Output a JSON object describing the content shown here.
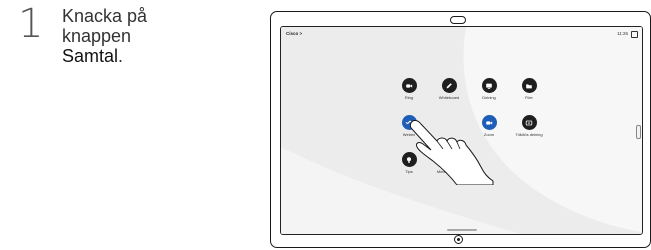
{
  "step": {
    "number": "1"
  },
  "instruction": {
    "line1": "Knacka på",
    "line2": "knappen",
    "button_name": "Samtal",
    "trailing": "."
  },
  "device": {
    "status": {
      "left": "Cisco >",
      "time": "11:26"
    },
    "apps": [
      {
        "label": "Ring",
        "icon": "call-icon"
      },
      {
        "label": "Whiteboard",
        "icon": "pencil-icon"
      },
      {
        "label": "Delning",
        "icon": "share-screen-icon"
      },
      {
        "label": "Filer",
        "icon": "folder-icon"
      },
      {
        "label": "Webex",
        "icon": "webex-icon",
        "color": "#1f5eb8"
      },
      {
        "label": "Zoom",
        "icon": "zoom-icon",
        "color": "#1f5eb8"
      },
      {
        "label": "Trådlös delning",
        "icon": "wireless-share-icon"
      },
      {
        "label": "Tips",
        "icon": "lightbulb-icon"
      },
      {
        "label": "Meddelanden",
        "icon": "message-icon"
      }
    ]
  },
  "colors": {
    "tile_dark": "#1f1f1f",
    "tile_blue": "#1f5eb8",
    "frame": "#1a1a1a"
  }
}
